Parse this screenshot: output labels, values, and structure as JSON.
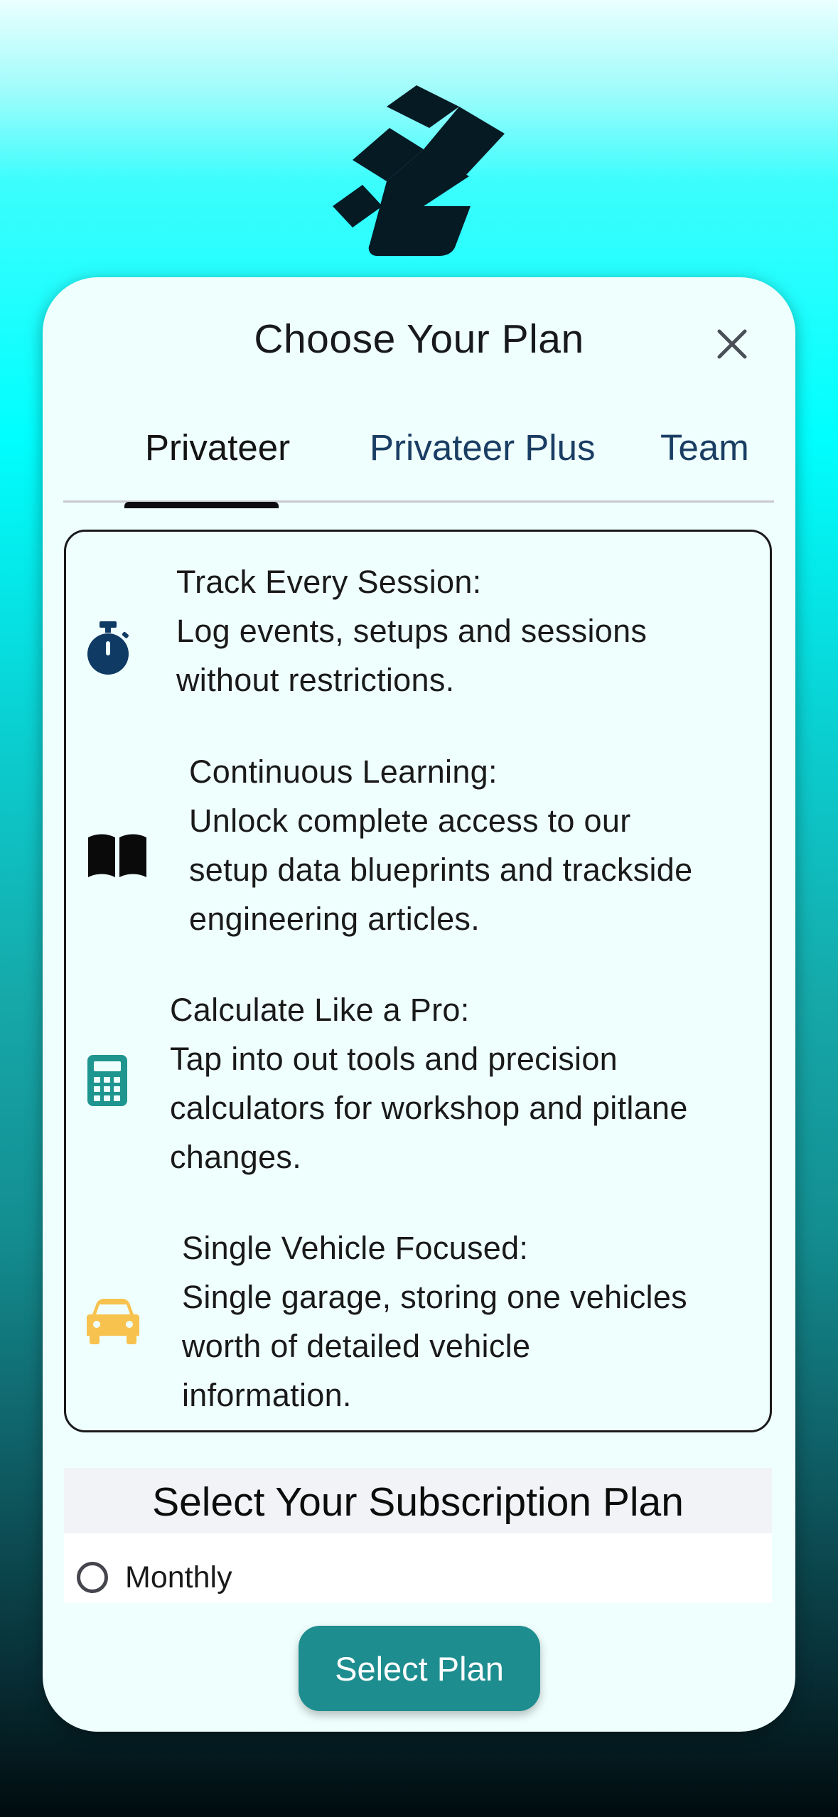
{
  "modal": {
    "title": "Choose Your Plan",
    "close_label": "close"
  },
  "tabs": [
    {
      "label": "Privateer",
      "active": true
    },
    {
      "label": "Privateer Plus",
      "active": false
    },
    {
      "label": "Team",
      "active": false
    }
  ],
  "features": [
    {
      "icon": "stopwatch-icon",
      "icon_color": "#0f3a63",
      "lines": [
        "Track Every Session:",
        "Log events, setups and sessions",
        "without restrictions."
      ]
    },
    {
      "icon": "book-open-icon",
      "icon_color": "#0a0a0a",
      "lines": [
        "Continuous Learning:",
        "Unlock complete access to our",
        "setup data blueprints and trackside",
        "engineering articles."
      ]
    },
    {
      "icon": "calculator-icon",
      "icon_color": "#1f958f",
      "lines": [
        "Calculate Like a Pro:",
        "Tap into out tools and precision",
        "calculators for workshop and pitlane",
        "changes."
      ]
    },
    {
      "icon": "car-icon",
      "icon_color": "#f8c24f",
      "lines": [
        "Single Vehicle Focused:",
        "Single garage, storing one vehicles",
        "worth of detailed vehicle",
        "information."
      ]
    }
  ],
  "subscription": {
    "heading": "Select Your Subscription Plan",
    "options": [
      {
        "label": "Monthly",
        "selected": false
      }
    ]
  },
  "select_button": {
    "label": "Select Plan",
    "color": "#1e8d8f"
  }
}
